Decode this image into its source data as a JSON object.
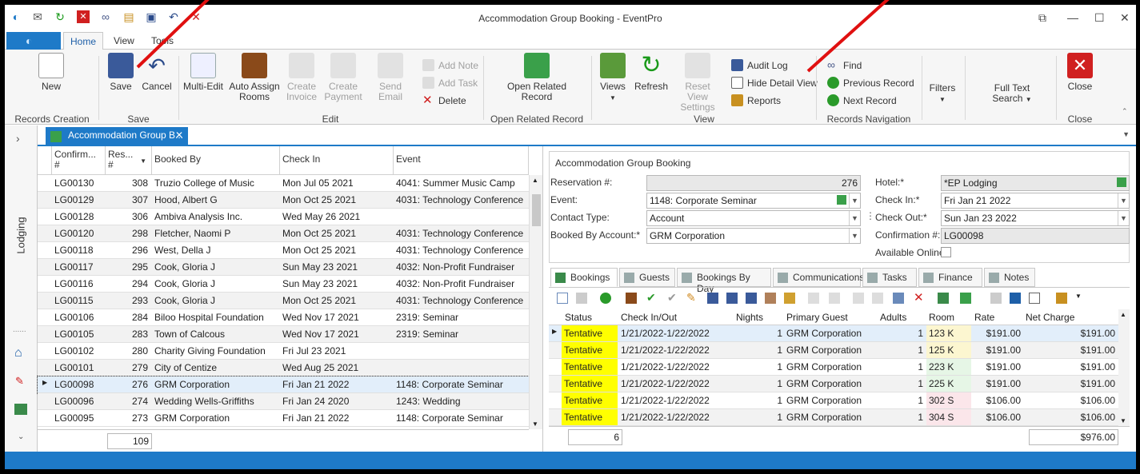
{
  "window": {
    "title": "Accommodation Group Booking - EventPro"
  },
  "ribbon_tabs": [
    "Home",
    "View",
    "Tools"
  ],
  "ribbon": {
    "new": "New",
    "group_records_creation": "Records Creation",
    "save": "Save",
    "cancel": "Cancel",
    "group_save": "Save",
    "multi_edit": "Multi-Edit",
    "auto_assign": "Auto Assign",
    "auto_assign2": "Rooms",
    "create_invoice": "Create",
    "create_invoice2": "Invoice",
    "create_payment": "Create",
    "create_payment2": "Payment",
    "send_email": "Send Email",
    "add_note": "Add Note",
    "add_task": "Add Task",
    "delete": "Delete",
    "group_edit": "Edit",
    "open_related": "Open Related",
    "open_related2": "Record",
    "group_open_related": "Open Related Record",
    "views": "Views",
    "refresh": "Refresh",
    "reset_view": "Reset View",
    "reset_view2": "Settings",
    "group_view": "View",
    "audit_log": "Audit Log",
    "hide_detail": "Hide Detail View",
    "reports": "Reports",
    "find": "Find",
    "previous": "Previous Record",
    "next": "Next Record",
    "group_nav": "Records Navigation",
    "filters": "Filters",
    "full_text": "Full Text",
    "full_text2": "Search",
    "close": "Close",
    "group_close": "Close"
  },
  "doc_tab": "Accommodation Group B...",
  "side_label": "Lodging",
  "grid": {
    "headers": [
      "Confirm...\n#",
      "Res...\n#",
      "Booked By",
      "Check In",
      "Event"
    ],
    "rows": [
      [
        "LG00130",
        "308",
        "Truzio College of Music",
        "Mon Jul 05 2021",
        "4041: Summer Music Camp"
      ],
      [
        "LG00129",
        "307",
        "Hood, Albert G",
        "Mon Oct 25 2021",
        "4031: Technology Conference"
      ],
      [
        "LG00128",
        "306",
        "Ambiva Analysis Inc.",
        "Wed May 26 2021",
        ""
      ],
      [
        "LG00120",
        "298",
        "Fletcher, Naomi P",
        "Mon Oct 25 2021",
        "4031: Technology Conference"
      ],
      [
        "LG00118",
        "296",
        "West, Della J",
        "Mon Oct 25 2021",
        "4031: Technology Conference"
      ],
      [
        "LG00117",
        "295",
        "Cook, Gloria J",
        "Sun May 23 2021",
        "4032: Non-Profit Fundraiser"
      ],
      [
        "LG00116",
        "294",
        "Cook, Gloria J",
        "Sun May 23 2021",
        "4032: Non-Profit Fundraiser"
      ],
      [
        "LG00115",
        "293",
        "Cook, Gloria J",
        "Mon Oct 25 2021",
        "4031: Technology Conference"
      ],
      [
        "LG00106",
        "284",
        "Biloo Hospital Foundation",
        "Wed Nov 17 2021",
        "2319: Seminar"
      ],
      [
        "LG00105",
        "283",
        "Town of Calcous",
        "Wed Nov 17 2021",
        "2319: Seminar"
      ],
      [
        "LG00102",
        "280",
        "Charity Giving Foundation",
        "Fri Jul 23 2021",
        ""
      ],
      [
        "LG00101",
        "279",
        "City of Centize",
        "Wed Aug 25 2021",
        ""
      ],
      [
        "LG00098",
        "276",
        "GRM Corporation",
        "Fri Jan 21 2022",
        "1148: Corporate Seminar"
      ],
      [
        "LG00096",
        "274",
        "Wedding Wells-Griffiths",
        "Fri Jan 24 2020",
        "1243: Wedding"
      ],
      [
        "LG00095",
        "273",
        "GRM Corporation",
        "Fri Jan 21 2022",
        "1148: Corporate Seminar"
      ]
    ],
    "count": "109"
  },
  "detail": {
    "group_title": "Accommodation Group Booking",
    "res_label": "Reservation #:",
    "res_value": "276",
    "event_label": "Event:",
    "event_value": "1148: Corporate Seminar",
    "contact_label": "Contact Type:",
    "contact_value": "Account",
    "booked_label": "Booked By Account:*",
    "booked_value": "GRM Corporation",
    "hotel_label": "Hotel:*",
    "hotel_value": "*EP Lodging",
    "checkin_label": "Check In:*",
    "checkin_value": "Fri Jan 21 2022",
    "checkout_label": "Check Out:*",
    "checkout_value": "Sun Jan 23 2022",
    "conf_label": "Confirmation #:",
    "conf_value": "LG00098",
    "online_label": "Available Online"
  },
  "tabs": [
    "Bookings",
    "Guests",
    "Bookings By Day",
    "Communications",
    "Tasks",
    "Finance",
    "Notes"
  ],
  "bookings": {
    "headers": [
      "Status",
      "Check In/Out",
      "Nights",
      "Primary Guest",
      "Adults",
      "Room",
      "Rate",
      "Net Charge"
    ],
    "rows": [
      [
        "Tentative",
        "1/21/2022-1/22/2022",
        "1",
        "GRM Corporation",
        "1",
        "123 K",
        "$191.00",
        "$191.00"
      ],
      [
        "Tentative",
        "1/21/2022-1/22/2022",
        "1",
        "GRM Corporation",
        "1",
        "125 K",
        "$191.00",
        "$191.00"
      ],
      [
        "Tentative",
        "1/21/2022-1/22/2022",
        "1",
        "GRM Corporation",
        "1",
        "223 K",
        "$191.00",
        "$191.00"
      ],
      [
        "Tentative",
        "1/21/2022-1/22/2022",
        "1",
        "GRM Corporation",
        "1",
        "225 K",
        "$191.00",
        "$191.00"
      ],
      [
        "Tentative",
        "1/21/2022-1/22/2022",
        "1",
        "GRM Corporation",
        "1",
        "302 S",
        "$106.00",
        "$106.00"
      ],
      [
        "Tentative",
        "1/21/2022-1/22/2022",
        "1",
        "GRM Corporation",
        "1",
        "304 S",
        "$106.00",
        "$106.00"
      ]
    ],
    "count": "6",
    "total": "$976.00"
  },
  "colors": {
    "accent": "#1e7ac8",
    "tentative": "#ffff00",
    "arrow": "#e01010"
  }
}
